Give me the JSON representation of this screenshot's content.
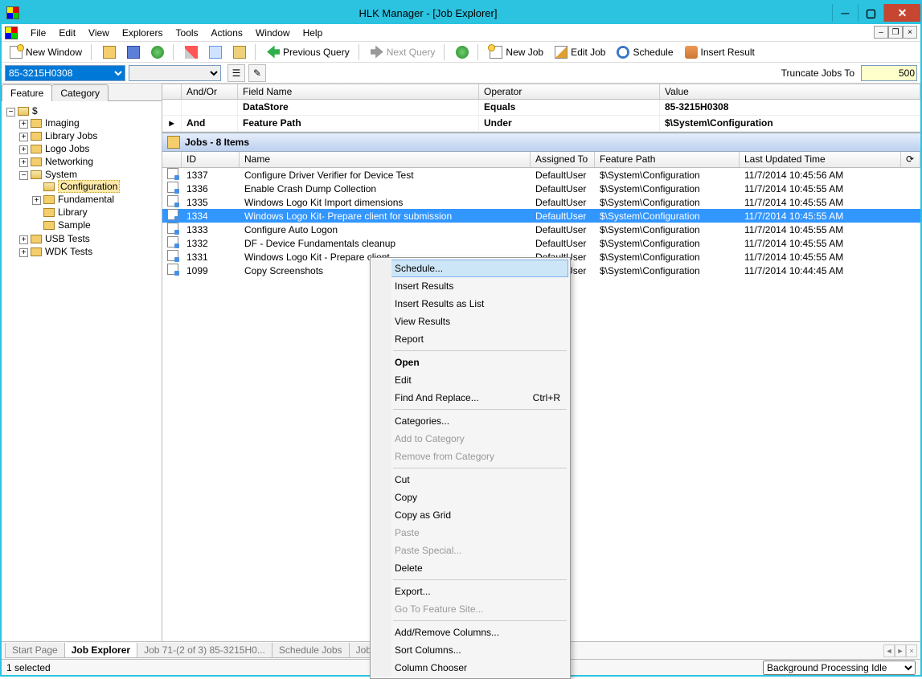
{
  "window": {
    "title": "HLK Manager - [Job Explorer]"
  },
  "menubar": [
    "File",
    "Edit",
    "View",
    "Explorers",
    "Tools",
    "Actions",
    "Window",
    "Help"
  ],
  "toolbar": {
    "new_window": "New Window",
    "previous_query": "Previous Query",
    "next_query": "Next Query",
    "new_job": "New Job",
    "edit_job": "Edit Job",
    "schedule": "Schedule",
    "insert_result": "Insert Result"
  },
  "filterbar": {
    "combo1": "85-3215H0308",
    "combo2": "",
    "truncate_label": "Truncate Jobs To",
    "truncate_value": "500"
  },
  "left_tabs": {
    "feature": "Feature",
    "category": "Category"
  },
  "tree": {
    "root": "$",
    "nodes": [
      "Imaging",
      "Library Jobs",
      "Logo Jobs",
      "Networking",
      "System",
      "USB Tests",
      "WDK Tests"
    ],
    "system_children": [
      "Configuration",
      "Fundamental",
      "Library",
      "Sample"
    ]
  },
  "query": {
    "headers": {
      "andor": "And/Or",
      "field": "Field Name",
      "op": "Operator",
      "val": "Value"
    },
    "rows": [
      {
        "andor": "",
        "field": "DataStore",
        "op": "Equals",
        "val": "85-3215H0308",
        "bold": true
      },
      {
        "andor": "And",
        "field": "Feature Path",
        "op": "Under",
        "val": "$\\System\\Configuration",
        "bold": true,
        "arrow": true
      }
    ]
  },
  "jobs_header": "Jobs - 8 Items",
  "jobs_cols": {
    "id": "ID",
    "name": "Name",
    "assigned": "Assigned To",
    "fp": "Feature Path",
    "lu": "Last Updated Time"
  },
  "jobs": [
    {
      "id": "1337",
      "name": "Configure Driver Verifier for Device Test",
      "assigned": "DefaultUser",
      "fp": "$\\System\\Configuration",
      "lu": "11/7/2014 10:45:56 AM"
    },
    {
      "id": "1336",
      "name": "Enable Crash Dump Collection",
      "assigned": "DefaultUser",
      "fp": "$\\System\\Configuration",
      "lu": "11/7/2014 10:45:55 AM"
    },
    {
      "id": "1335",
      "name": "Windows Logo Kit Import dimensions",
      "assigned": "DefaultUser",
      "fp": "$\\System\\Configuration",
      "lu": "11/7/2014 10:45:55 AM"
    },
    {
      "id": "1334",
      "name": "Windows Logo Kit- Prepare client for submission",
      "assigned": "DefaultUser",
      "fp": "$\\System\\Configuration",
      "lu": "11/7/2014 10:45:55 AM",
      "selected": true
    },
    {
      "id": "1333",
      "name": "Configure Auto Logon",
      "assigned": "DefaultUser",
      "fp": "$\\System\\Configuration",
      "lu": "11/7/2014 10:45:55 AM"
    },
    {
      "id": "1332",
      "name": "DF - Device Fundamentals cleanup",
      "assigned": "DefaultUser",
      "fp": "$\\System\\Configuration",
      "lu": "11/7/2014 10:45:55 AM"
    },
    {
      "id": "1331",
      "name": "Windows Logo Kit - Prepare client",
      "assigned": "DefaultUser",
      "fp": "$\\System\\Configuration",
      "lu": "11/7/2014 10:45:55 AM"
    },
    {
      "id": "1099",
      "name": "Copy Screenshots",
      "assigned": "DefaultUser",
      "fp": "$\\System\\Configuration",
      "lu": "11/7/2014 10:44:45 AM"
    }
  ],
  "context_menu": [
    {
      "label": "Schedule...",
      "hover": true
    },
    {
      "label": "Insert Results"
    },
    {
      "label": "Insert Results as List"
    },
    {
      "label": "View Results"
    },
    {
      "label": "Report"
    },
    {
      "sep": true
    },
    {
      "label": "Open",
      "bold": true
    },
    {
      "label": "Edit"
    },
    {
      "label": "Find And Replace...",
      "shortcut": "Ctrl+R"
    },
    {
      "sep": true
    },
    {
      "label": "Categories..."
    },
    {
      "label": "Add to Category",
      "disabled": true
    },
    {
      "label": "Remove from Category",
      "disabled": true
    },
    {
      "sep": true
    },
    {
      "label": "Cut"
    },
    {
      "label": "Copy"
    },
    {
      "label": "Copy as Grid"
    },
    {
      "label": "Paste",
      "disabled": true
    },
    {
      "label": "Paste Special...",
      "disabled": true
    },
    {
      "label": "Delete"
    },
    {
      "sep": true
    },
    {
      "label": "Export..."
    },
    {
      "label": "Go To Feature Site...",
      "disabled": true
    },
    {
      "sep": true
    },
    {
      "label": "Add/Remove Columns..."
    },
    {
      "label": "Sort Columns..."
    },
    {
      "label": "Column Chooser"
    }
  ],
  "bottom_tabs": [
    "Start Page",
    "Job Explorer",
    "Job 71-(2 of 3) 85-3215H0...",
    "Schedule Jobs",
    "Job Monitor"
  ],
  "status": {
    "left": "1 selected",
    "right": "Background Processing Idle"
  }
}
